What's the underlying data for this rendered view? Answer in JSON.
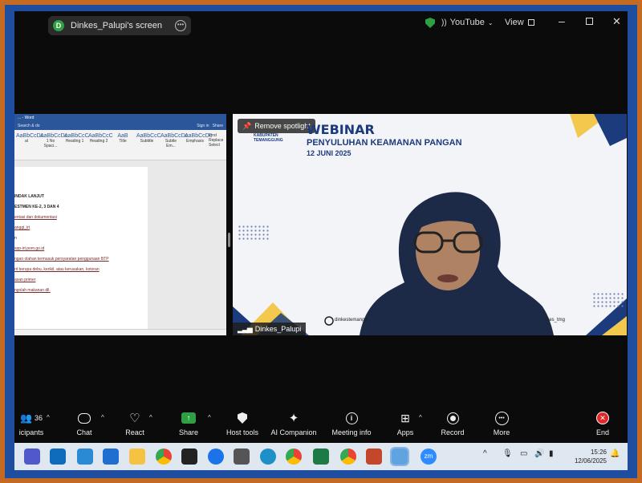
{
  "topbar": {
    "share_initial": "D",
    "share_label": "Dinkes_Palupi's screen",
    "youtube_label": "YouTube",
    "view_label": "View"
  },
  "word": {
    "title": "... - Word",
    "search": "Search & do",
    "style_samples": [
      "AaBbCcDc",
      "AaBbCcDc",
      "AaBbCcC",
      "AaBbCcC",
      "AaB",
      "AaBbCcC",
      "AaBbCcDc",
      "AaBbCcDc"
    ],
    "style_names": [
      "al",
      "1 No Spaci...",
      "Heading 1",
      "Heading 2",
      "Title",
      "Subtitle",
      "Subtle Em...",
      "Emphasis"
    ],
    "editing": [
      "Find",
      "Replace",
      "Select"
    ],
    "signin": "Sign in",
    "share": "Share",
    "lines": [
      {
        "t": "INDAK LANJUT",
        "s": "b"
      },
      {
        "t": "ESTMEN KE-2, 3 DAN 4",
        "s": "b"
      },
      {
        "t": "",
        "s": ""
      },
      {
        "t": "entasi dan dokumentasi",
        "s": "u"
      },
      {
        "t": "anggi_irt",
        "s": "u"
      },
      {
        "t": "",
        "s": ""
      },
      {
        "t": "n",
        "s": ""
      },
      {
        "t": "spp-irt.pom.go.id",
        "s": "u"
      },
      {
        "t": "",
        "s": ""
      },
      {
        "t": "ngan olahan termasuk persyaratan penggunaan BTP",
        "s": "u"
      },
      {
        "t": "",
        "s": ""
      },
      {
        "t": "rit berupa debu, kerikil, atau kerusakan, kotoran",
        "s": "u"
      },
      {
        "t": "",
        "s": ""
      },
      {
        "t": "asan primer",
        "s": "u"
      },
      {
        "t": "ngolah makanan dll.",
        "s": "u"
      }
    ]
  },
  "video": {
    "remove_spotlight": "Remove spotlight",
    "logo_text_1": "KABUPATEN",
    "logo_text_2": "TEMANGGUNG",
    "webinar": "WEBINAR",
    "subtitle": "PENYULUHAN KEAMANAN PANGAN",
    "date": "12 JUNI 2025",
    "instagram_left": "dinkestemangg",
    "instagram_right": "nkes_tmg",
    "participant_name": "Dinkes_Palupi"
  },
  "toolbar": {
    "participants_count": "36",
    "participants_label": "icipants",
    "items": [
      "Chat",
      "React",
      "Share",
      "Host tools",
      "AI Companion",
      "Meeting info",
      "Apps",
      "Record",
      "More",
      "End"
    ]
  },
  "taskbar": {
    "time": "15:26",
    "date": "12/06/2025"
  },
  "colors": {
    "accent_green": "#2ea043",
    "navy": "#1b3b7c",
    "frame_orange": "#c56a22",
    "frame_blue": "#1f4ea0",
    "end_red": "#e02828"
  }
}
